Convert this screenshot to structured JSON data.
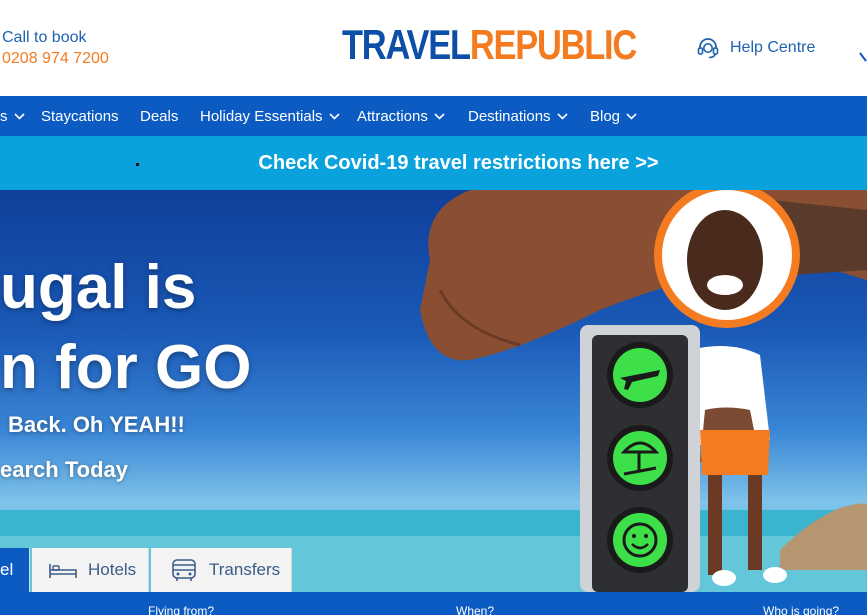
{
  "header": {
    "call_label": "Call to book",
    "call_phone": "0208 974 7200",
    "logo_part1": "TRAVEL",
    "logo_part2": "REPUBLIC",
    "help_label": "Help Centre"
  },
  "nav": {
    "items": [
      {
        "label": "s",
        "dropdown": true
      },
      {
        "label": "Staycations",
        "dropdown": false
      },
      {
        "label": "Deals",
        "dropdown": false
      },
      {
        "label": "Holiday Essentials",
        "dropdown": true
      },
      {
        "label": "Attractions",
        "dropdown": true
      },
      {
        "label": "Destinations",
        "dropdown": true
      },
      {
        "label": "Blog",
        "dropdown": true
      }
    ]
  },
  "covid_banner": {
    "text": "Check Covid-19 travel restrictions here >>"
  },
  "hero": {
    "headline_line1": "ugal is",
    "headline_line2": "n for GO",
    "sub_line1": "Back. Oh YEAH!!",
    "sub_line2": "earch Today"
  },
  "search_tabs": [
    {
      "label": "el",
      "active": true,
      "icon": ""
    },
    {
      "label": "Hotels",
      "active": false,
      "icon": "bed-icon"
    },
    {
      "label": "Transfers",
      "active": false,
      "icon": "bus-icon"
    }
  ],
  "search_fields": {
    "from_label": "Flying from?",
    "when_label": "When?",
    "who_label": "Who is going?"
  },
  "colors": {
    "brand_blue": "#0b5bc3",
    "brand_orange": "#f47b20",
    "banner_cyan": "#0aa2dc",
    "light_green": "#3ee04a"
  }
}
